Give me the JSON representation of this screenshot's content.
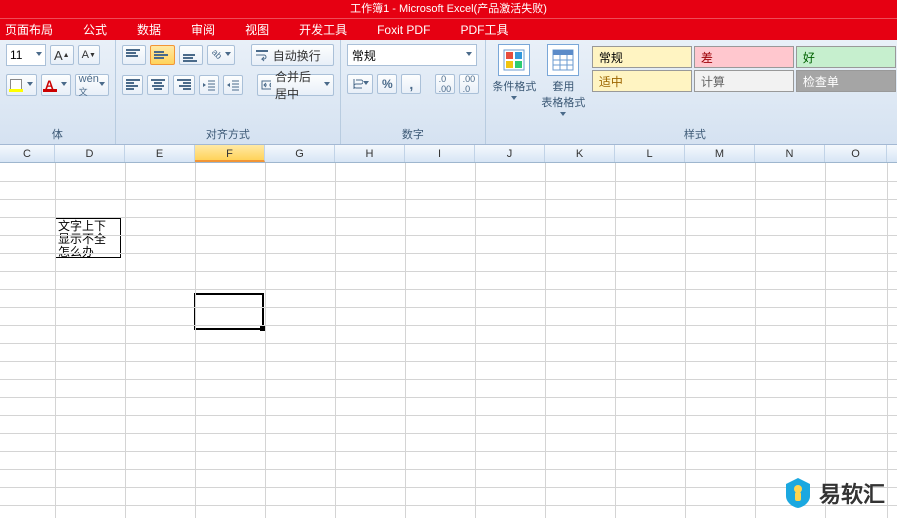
{
  "title": "工作簿1 - Microsoft Excel(产品激活失败)",
  "menu": {
    "pagelayout": "页面布局",
    "formulas": "公式",
    "data": "数据",
    "review": "审阅",
    "view": "视图",
    "dev": "开发工具",
    "foxit": "Foxit PDF",
    "pdftool": "PDF工具"
  },
  "font": {
    "size": "11",
    "group_label": "体"
  },
  "align": {
    "wrap": "自动换行",
    "merge": "合并后居中",
    "group_label": "对齐方式"
  },
  "number": {
    "format": "常规",
    "group_label": "数字"
  },
  "styles": {
    "condfmt": "条件格式",
    "tablefmt": "套用\n表格格式",
    "group_label": "样式",
    "normal": "常规",
    "bad": "差",
    "good": "好",
    "neutral": "适中",
    "calc": "计算",
    "check": "检查单"
  },
  "columns": [
    "C",
    "D",
    "E",
    "F",
    "G",
    "H",
    "I",
    "J",
    "K",
    "L",
    "M",
    "N",
    "O"
  ],
  "cell_d4": "文字上下\n显示不全\n怎么办",
  "watermark": "易软汇"
}
